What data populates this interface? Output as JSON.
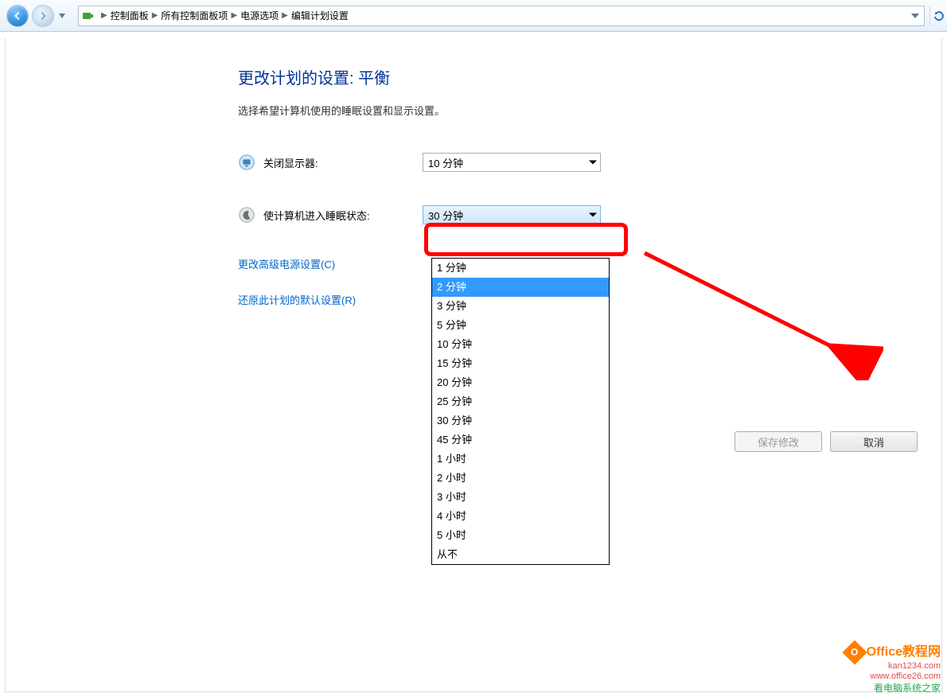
{
  "breadcrumbs": [
    "控制面板",
    "所有控制面板项",
    "电源选项",
    "编辑计划设置"
  ],
  "page": {
    "title": "更改计划的设置: 平衡",
    "subtitle": "选择希望计算机使用的睡眠设置和显示设置。"
  },
  "settings": {
    "display_off": {
      "label": "关闭显示器:",
      "value": "10 分钟"
    },
    "sleep": {
      "label": "使计算机进入睡眠状态:",
      "value": "30 分钟"
    }
  },
  "dropdown_options": [
    "1 分钟",
    "2 分钟",
    "3 分钟",
    "5 分钟",
    "10 分钟",
    "15 分钟",
    "20 分钟",
    "25 分钟",
    "30 分钟",
    "45 分钟",
    "1 小时",
    "2 小时",
    "3 小时",
    "4 小时",
    "5 小时",
    "从不"
  ],
  "dropdown_highlight_index": 1,
  "links": {
    "advanced": "更改高级电源设置(C)",
    "restore": "还原此计划的默认设置(R)"
  },
  "buttons": {
    "save": "保存修改",
    "cancel": "取消"
  },
  "watermark": {
    "office": "Office教程网",
    "kan": "kan1234.com",
    "url1": "www.office26.com",
    "url2": "看电脑系统之家"
  }
}
